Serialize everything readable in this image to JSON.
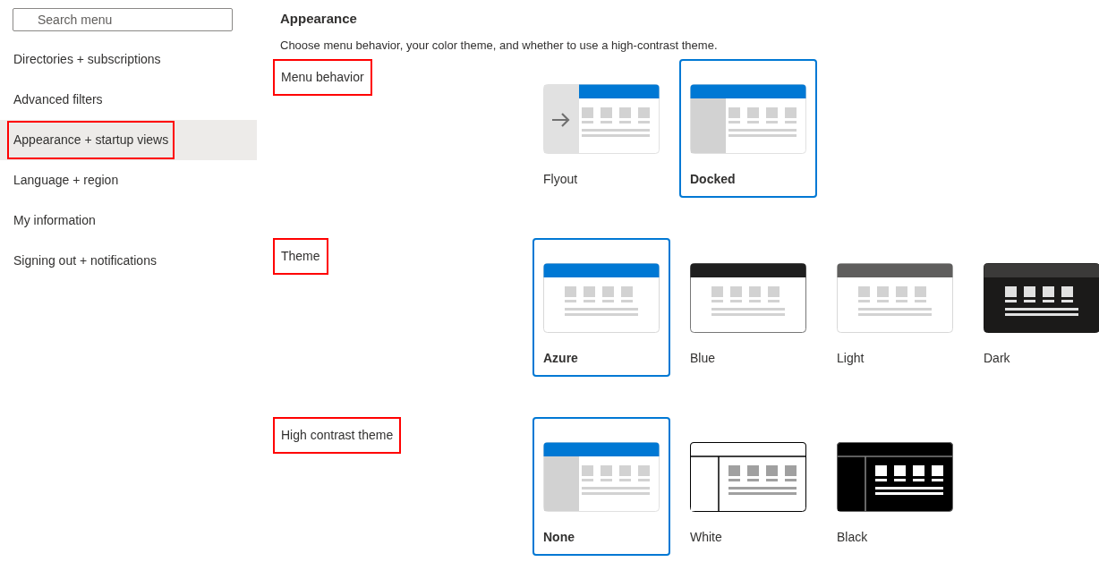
{
  "sidebar": {
    "search": {
      "placeholder": "Search menu"
    },
    "items": [
      {
        "label": "Directories + subscriptions",
        "selected": false,
        "highlighted": false
      },
      {
        "label": "Advanced filters",
        "selected": false,
        "highlighted": false
      },
      {
        "label": "Appearance + startup views",
        "selected": true,
        "highlighted": true
      },
      {
        "label": "Language + region",
        "selected": false,
        "highlighted": false
      },
      {
        "label": "My information",
        "selected": false,
        "highlighted": false
      },
      {
        "label": "Signing out + notifications",
        "selected": false,
        "highlighted": false
      }
    ]
  },
  "main": {
    "title": "Appearance",
    "description": "Choose menu behavior, your color theme, and whether to use a high-contrast theme.",
    "sections": [
      {
        "label": "Menu behavior",
        "highlighted": true,
        "options": [
          {
            "label": "Flyout",
            "kind": "flyout",
            "selected": false
          },
          {
            "label": "Docked",
            "kind": "docked",
            "selected": true
          }
        ]
      },
      {
        "label": "Theme",
        "highlighted": true,
        "options": [
          {
            "label": "Azure",
            "kind": "azure",
            "selected": true
          },
          {
            "label": "Blue",
            "kind": "blue",
            "selected": false
          },
          {
            "label": "Light",
            "kind": "light",
            "selected": false
          },
          {
            "label": "Dark",
            "kind": "dark",
            "selected": false
          }
        ]
      },
      {
        "label": "High contrast theme",
        "highlighted": true,
        "options": [
          {
            "label": "None",
            "kind": "none",
            "selected": true
          },
          {
            "label": "White",
            "kind": "white",
            "selected": false
          },
          {
            "label": "Black",
            "kind": "black",
            "selected": false
          }
        ]
      }
    ]
  }
}
